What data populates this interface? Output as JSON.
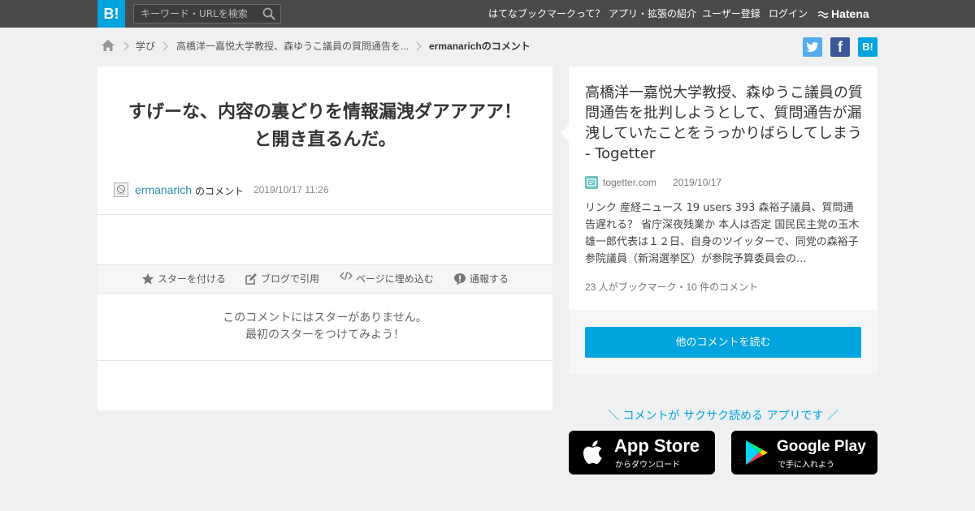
{
  "header": {
    "logo": "B!",
    "search_placeholder": "キーワード・URLを検索",
    "nav": [
      "はてなブックマークって？",
      "アプリ・拡張の紹介",
      "ユーザー登録",
      "ログイン"
    ],
    "brand": "Hatena"
  },
  "breadcrumb": {
    "items": [
      "学び",
      "高橋洋一嘉悦大学教授、森ゆうこ議員の質問通告を...",
      "ermanarichのコメント"
    ]
  },
  "social": {
    "twitter": "t",
    "facebook": "f",
    "hatena": "B!"
  },
  "comment": {
    "text_line1": "すげーな、内容の裏どりを情報漏洩ダアアアア！",
    "text_line2": "と開き直るんだ。",
    "user": "ermanarich",
    "suffix": "のコメント",
    "date": "2019/10/17 11:26"
  },
  "actions": [
    "スターを付ける",
    "ブログで引用",
    "ページに埋め込む",
    "通報する"
  ],
  "stars": {
    "line1": "このコメントにはスターがありません。",
    "line2": "最初のスターをつけてみよう！"
  },
  "entry": {
    "title": "高橋洋一嘉悦大学教授、森ゆうこ議員の質問通告を批判しようとして、質問通告が漏洩していたことをうっかりばらしてしまう - Togetter",
    "domain": "togetter.com",
    "date": "2019/10/17",
    "summary": "リンク 産経ニュース 19 users 393 森裕子議員、質問通告遅れる？ 省庁深夜残業か 本人は否定 国民民主党の玉木雄一郎代表は１２日、自身のツイッターで、同党の森裕子参院議員（新潟選挙区）が参院予算委員会の...",
    "counts": "23 人がブックマーク・10 件のコメント",
    "read_button": "他のコメントを読む"
  },
  "apps": {
    "tagline": "＼ コメントが サクサク読める アプリです ／",
    "appstore_big": "App Store",
    "appstore_small": "からダウンロード",
    "google_big": "Google Play",
    "google_small": "で手に入れよう"
  },
  "colors": {
    "accent": "#00a4de",
    "topbar": "#4a4a4a",
    "twitter": "#55acee",
    "facebook": "#3b5998"
  }
}
